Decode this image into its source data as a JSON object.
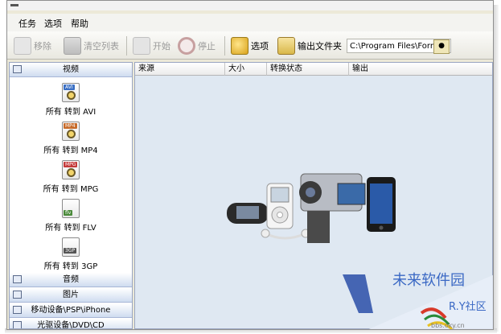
{
  "menu": [
    "任务",
    "选项",
    "帮助"
  ],
  "toolbar": {
    "remove": "移除",
    "clear_list": "清空列表",
    "start": "开始",
    "stop": "停止",
    "options": "选项",
    "output_folder": "输出文件夹",
    "output_path": "C:\\Program Files\\Form."
  },
  "sidebar": {
    "video": "视频",
    "items": [
      {
        "label": "所有 转到 AVI",
        "icon_text": "AVI",
        "color": "#3a6fc4"
      },
      {
        "label": "所有 转到 MP4",
        "icon_text": "MP4",
        "color": "#c76b2a"
      },
      {
        "label": "所有 转到 MPG",
        "icon_text": "MPG",
        "color": "#c43a3a"
      },
      {
        "label": "所有 转到 FLV",
        "icon_text": "flv",
        "color": "#4a8a3a"
      },
      {
        "label": "所有 转到 3GP",
        "icon_text": "3GP",
        "color": "#555555"
      }
    ],
    "audio": "音频",
    "image": "图片",
    "mobile": "移动设备\\PSP\\iPhone",
    "optical": "光驱设备\\DVD\\CD"
  },
  "columns": [
    "来源",
    "大小",
    "转换状态",
    "输出"
  ],
  "watermark": {
    "site_name": "未来软件园",
    "community": "R.Y社区",
    "url": "bbs.oky.cn"
  }
}
